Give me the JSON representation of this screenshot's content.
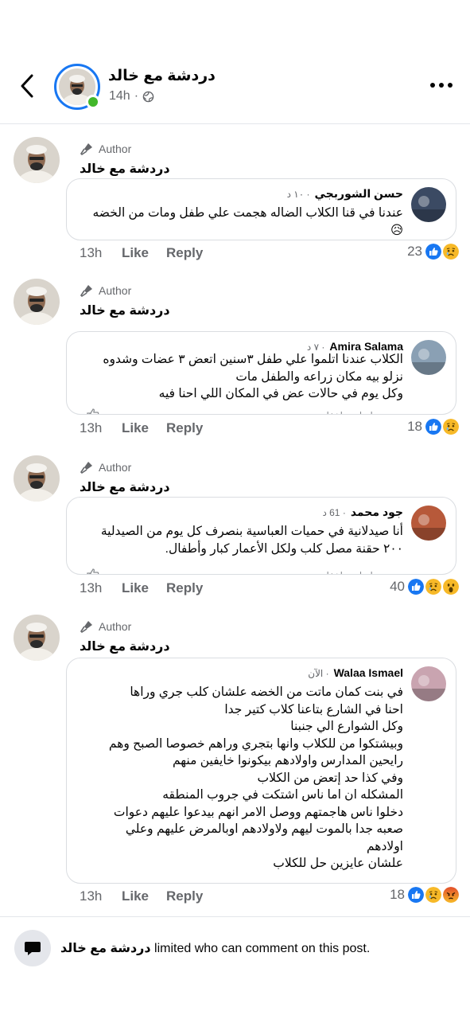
{
  "header": {
    "page_name": "دردشة مع خالد",
    "time": "14h",
    "privacy_icon": "globe-icon"
  },
  "author_label": "Author",
  "page_name": "دردشة مع خالد",
  "actions": {
    "time": "13h",
    "like": "Like",
    "reply": "Reply"
  },
  "ghost_actions": [
    "رد",
    "مراسلة",
    "إخفاء"
  ],
  "colors": {
    "blue": "#1877f2",
    "online": "#42b72a",
    "sad": "#f7b928",
    "angry": "#e9710f"
  },
  "comments": [
    {
      "reply_name": "حسن الشوربجي",
      "reply_time": "١٠ د",
      "lines": [
        "عندنا في قنا الكلاب الضاله هجمت علي طفل ومات من الخضه",
        "😥"
      ],
      "reactions": [
        "like",
        "sad"
      ],
      "count": "23"
    },
    {
      "reply_name": "Amira Salama",
      "reply_time": "٧ د",
      "lines": [
        "الكلاب عندنا اتلموا علي طفل ٣سنين اتعض ٣ عضات وشدوه",
        "نزلو بيه مكان زراعه والطفل مات",
        "وكل يوم في حالات عض في المكان اللي احنا فيه"
      ],
      "reactions": [
        "like",
        "sad"
      ],
      "count": "18"
    },
    {
      "reply_name": "جود محمد",
      "reply_time": "61 د",
      "lines": [
        "أنا صيدلانية في حميات العباسية بنصرف كل يوم من الصيدلية",
        "٢٠٠ حقنة مصل كلب ولكل الأعمار كبار وأطفال."
      ],
      "reactions": [
        "like",
        "sad",
        "wow"
      ],
      "count": "40"
    },
    {
      "reply_name": "Walaa Ismael",
      "reply_time": "الآن",
      "lines": [
        "في بنت كمان ماتت من الخضه علشان كلب جري وراها",
        "احنا في الشارع بتاعنا كلاب كتير جدا",
        "وكل الشوارع الي جنبنا",
        "وبيشتكوا من للكلاب وانها بتجري وراهم خصوصا الصبح وهم",
        "رايحين المدارس واولادهم بيكونوا خايفين منهم",
        "وفي كذا حد إتعض من الكلاب",
        "المشكله ان اما ناس اشتكت في جروب المنطقه",
        "دخلوا ناس هاجمتهم ووصل الامر انهم بيدعوا عليهم دعوات",
        "صعبه جدا بالموت ليهم ولاولادهم اوبالمرض عليهم وعلي",
        "اولادهم",
        "علشان عايزين حل للكلاب"
      ],
      "reactions": [
        "like",
        "sad",
        "angry"
      ],
      "count": "18"
    }
  ],
  "footer": {
    "page_name": "دردشة مع خالد",
    "text": "limited who can comment on this post."
  }
}
